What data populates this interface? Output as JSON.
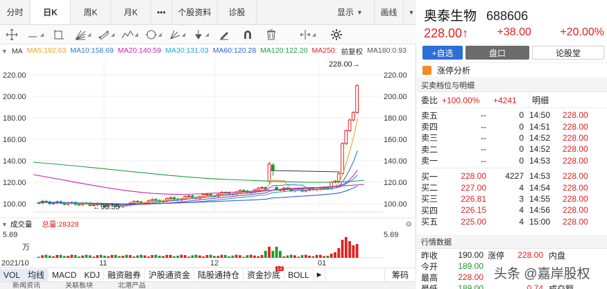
{
  "tabs": [
    {
      "label": "分时"
    },
    {
      "label": "日K"
    },
    {
      "label": "周K"
    },
    {
      "label": "月K"
    },
    {
      "label": "•••"
    },
    {
      "label": "个股资料"
    },
    {
      "label": "诊股"
    },
    {
      "label": "显示"
    },
    {
      "label": "画线"
    }
  ],
  "ma_legend": {
    "title": "MA",
    "items": [
      {
        "label": "MA5:192.63",
        "color": "#f0a020"
      },
      {
        "label": "MA10:158.69",
        "color": "#2a7bd0"
      },
      {
        "label": "MA20:140.59",
        "color": "#d020b0"
      },
      {
        "label": "MA30:131.03",
        "color": "#20a8c8"
      },
      {
        "label": "MA60:120.28",
        "color": "#2a60d0"
      },
      {
        "label": "MA120:122.20",
        "color": "#20a040"
      },
      {
        "label": "MA250:",
        "color": "#e02020"
      },
      {
        "label": "前复权",
        "color": "#333333"
      },
      {
        "label": "MA180:0.93",
        "color": "#555555"
      }
    ]
  },
  "kline": {
    "y_ticks_left": [
      "220.00",
      "200.00",
      "180.00",
      "160.00",
      "140.00",
      "120.00",
      "100.00"
    ],
    "y_ticks_right": [
      "220.00",
      "200.00",
      "180.00",
      "160.00",
      "140.00",
      "120.00",
      "100.00"
    ],
    "x_labels": [
      "2021/10",
      "11",
      "12",
      "01"
    ],
    "high_label": "228.00→",
    "low_label": "←98.55"
  },
  "volume": {
    "title": "成交量",
    "total_label": "总量:28328",
    "tick_top": "5.69",
    "tick_unit": "万",
    "tick_top_right": "5.69"
  },
  "bottom_tabs": [
    {
      "label": "VOL"
    },
    {
      "label": "均线"
    },
    {
      "label": "MACD"
    },
    {
      "label": "KDJ"
    },
    {
      "label": "融资融券"
    },
    {
      "label": "沪股通资金"
    },
    {
      "label": "陆股通持仓"
    },
    {
      "label": "资金抄底"
    },
    {
      "label": "BOLL"
    },
    {
      "label": "筹码"
    }
  ],
  "bottom_badge": "L2",
  "strip_labels": [
    "新闻资讯",
    "关联板块",
    "北港产品"
  ],
  "quote": {
    "name": "奥泰生物",
    "code": "688606",
    "price": "228.00",
    "arrow": "↑",
    "change": "+38.00",
    "change_pct": "+20.00%",
    "add_button": "+自选",
    "tab_market": "盘口",
    "tab_forum": "论股堂",
    "limit_up": "涨停分析",
    "book_title": "买卖档位与明细",
    "weibi_label": "委比",
    "weibi_pct": "+100.00%",
    "weibi_diff": "+4241",
    "detail_label": "明细",
    "sells": [
      {
        "label": "卖五",
        "price": "--",
        "qty": "0"
      },
      {
        "label": "卖四",
        "price": "--",
        "qty": "0"
      },
      {
        "label": "卖三",
        "price": "--",
        "qty": "0"
      },
      {
        "label": "卖二",
        "price": "--",
        "qty": "0"
      },
      {
        "label": "卖一",
        "price": "--",
        "qty": "0"
      }
    ],
    "buys": [
      {
        "label": "买一",
        "price": "228.00",
        "qty": "4227"
      },
      {
        "label": "买二",
        "price": "227.00",
        "qty": "4"
      },
      {
        "label": "买三",
        "price": "226.81",
        "qty": "3"
      },
      {
        "label": "买四",
        "price": "226.15",
        "qty": "4"
      },
      {
        "label": "买五",
        "price": "225.00",
        "qty": "4"
      }
    ],
    "trades": [
      {
        "time": "14:50",
        "price": "228.00"
      },
      {
        "time": "14:51",
        "price": "228.00"
      },
      {
        "time": "14:52",
        "price": "228.00"
      },
      {
        "time": "14:52",
        "price": "228.00"
      },
      {
        "time": "14:53",
        "price": "228.00"
      },
      {
        "time": "14:53",
        "price": "228.00"
      },
      {
        "time": "14:54",
        "price": "228.00"
      },
      {
        "time": "14:55",
        "price": "228.00"
      },
      {
        "time": "14:56",
        "price": "228.00"
      },
      {
        "time": "15:00",
        "price": "228.00"
      }
    ],
    "stats_title": "行情数据",
    "stats": [
      {
        "a": "昨收",
        "av": "190.00",
        "b": "涨停",
        "bv": "228.00",
        "c": "内盘",
        "cv": ""
      },
      {
        "a": "今开",
        "av": "189.00",
        "b": "",
        "bv": "",
        "c": "",
        "cv": ""
      },
      {
        "a": "最高",
        "av": "228.00",
        "b": "",
        "bv": "",
        "c": "",
        "cv": ""
      },
      {
        "a": "最低",
        "av": "189.00",
        "b": "",
        "bv": "0.74",
        "c": "成交额",
        "cv": ""
      }
    ]
  },
  "watermark": "头条 @嘉岸股权"
}
